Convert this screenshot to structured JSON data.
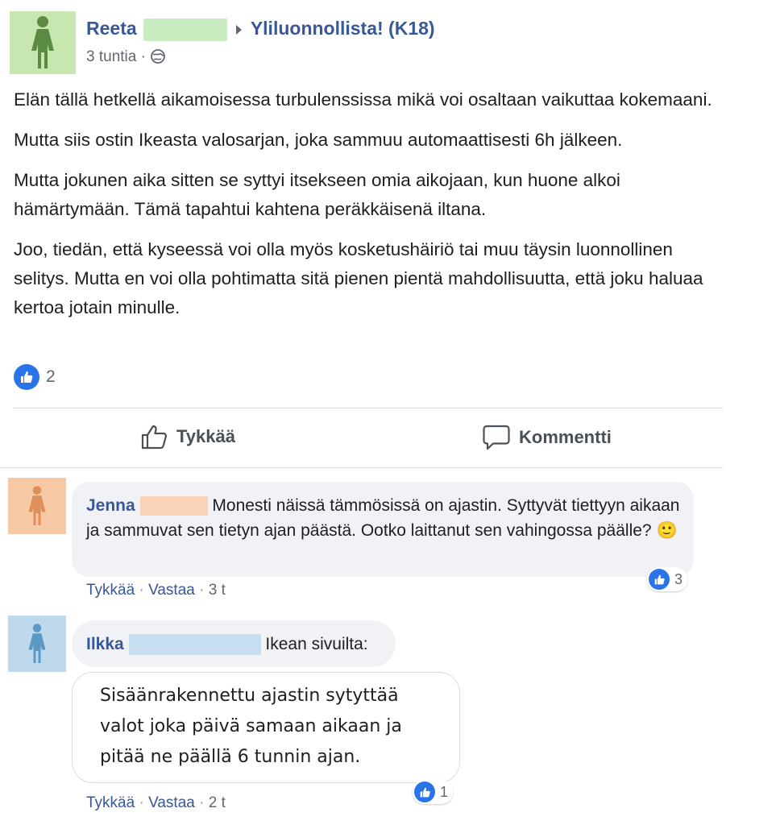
{
  "post": {
    "author_name": "Reeta",
    "group_name": "Yliluonnollista! (K18)",
    "time": "3 tuntia",
    "time_sep": "·",
    "paragraphs": [
      "Elän tällä hetkellä aikamoisessa turbulenssissa mikä voi osaltaan vaikuttaa kokemaani.",
      "Mutta siis ostin Ikeasta valosarjan, joka sammuu automaattisesti 6h jälkeen.",
      "Mutta jokunen aika sitten se syttyi itsekseen omia aikojaan, kun huone alkoi hämärtymään. Tämä tapahtui kahtena peräkkäisenä iltana.",
      "Joo, tiedän, että kyseessä voi olla myös kosketushäiriö tai muu täysin luonnollinen selitys. Mutta en voi olla pohtimatta sitä pienen pientä mahdollisuutta, että joku haluaa kertoa jotain minulle."
    ],
    "reaction_count": "2",
    "actions": {
      "like_label": "Tykkää",
      "comment_label": "Kommentti"
    }
  },
  "comments": [
    {
      "author_name": "Jenna",
      "text": "Monesti näissä tämmösissä on ajastin. Syttyvät tiettyyn aikaan ja sammuvat sen tietyn ajan päästä. Ootko laittanut sen vahingossa päälle?",
      "emoji": "🙂",
      "reaction_count": "3",
      "like_label": "Tykkää",
      "reply_label": "Vastaa",
      "time": "3 t",
      "sep": "·"
    },
    {
      "author_name": "Ilkka",
      "text": "Ikean sivuilta:",
      "quote": "Sisäänrakennettu ajastin sytyttää valot joka päivä samaan aikaan ja pitää ne päällä 6 tunnin ajan.",
      "reaction_count": "1",
      "like_label": "Tykkää",
      "reply_label": "Vastaa",
      "time": "2 t",
      "sep": "·"
    }
  ],
  "colors": {
    "link": "#385898",
    "like_blue": "#2a74ea",
    "reeta_avatar_bg": "#c7e6b0",
    "reeta_avatar_fg": "#5b8a43",
    "reeta_redact": "#c9ecc0",
    "jenna_avatar_bg": "#f7c9a5",
    "jenna_avatar_fg": "#e08e5a",
    "jenna_redact": "#f9d2b8",
    "ilkka_avatar_bg": "#bfd9ec",
    "ilkka_avatar_fg": "#5b98c3",
    "ilkka_redact": "#c6def0"
  },
  "icons": [
    "person-icon",
    "caret-right-icon",
    "globe-icon",
    "like-icon",
    "thumb-up-icon",
    "comment-bubble-icon",
    "smiley-emoji"
  ]
}
